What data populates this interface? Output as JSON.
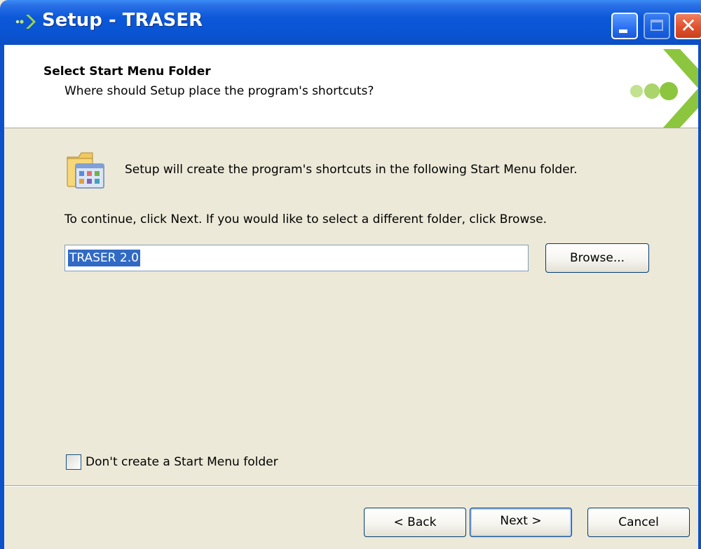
{
  "window": {
    "title": "Setup - TRASER",
    "close_glyph": "✕"
  },
  "header": {
    "title": "Select Start Menu Folder",
    "subtitle": "Where should Setup place the program's shortcuts?",
    "logo_icon": "green-dots-arrow-icon"
  },
  "body": {
    "intro": "Setup will create the program's shortcuts in the following Start Menu folder.",
    "continue_hint": "To continue, click Next. If you would like to select a different folder, click Browse.",
    "folder_value": "TRASER 2.0",
    "browse_label": "Browse...",
    "no_folder_label": "Don't create a Start Menu folder",
    "no_folder_checked": false
  },
  "footer": {
    "back_label": "< Back",
    "next_label": "Next >",
    "cancel_label": "Cancel"
  },
  "colors": {
    "titlebar": "#0b58d9",
    "accent_green": "#8cc63f",
    "selection": "#316ac5",
    "face": "#ece9d8"
  }
}
